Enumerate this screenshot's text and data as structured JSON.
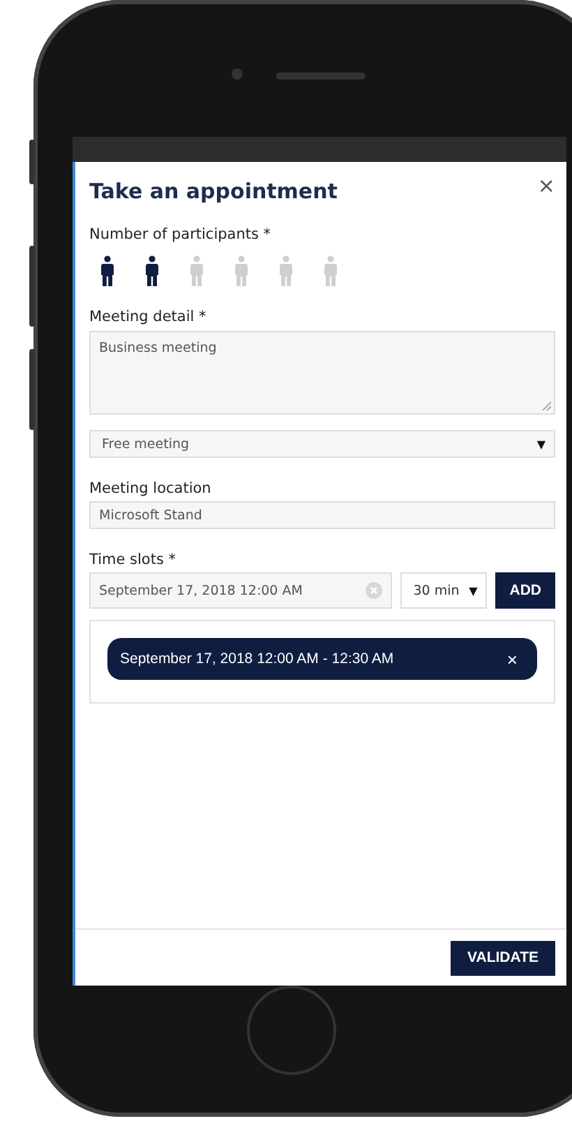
{
  "dialog": {
    "title": "Take an appointment",
    "close": "×"
  },
  "participants": {
    "label": "Number of participants *",
    "people": [
      {
        "selected": true
      },
      {
        "selected": true
      },
      {
        "selected": false
      },
      {
        "selected": false
      },
      {
        "selected": false
      },
      {
        "selected": false
      }
    ]
  },
  "meeting_detail": {
    "label": "Meeting detail *",
    "value": "Business meeting"
  },
  "meeting_type": {
    "value": "Free meeting",
    "caret": "▼"
  },
  "meeting_location": {
    "label": "Meeting location",
    "value": "Microsoft Stand"
  },
  "time_slots": {
    "label": "Time slots *",
    "date_value": "September 17, 2018 12:00 AM",
    "duration": "30 min",
    "caret": "▼",
    "add_button": "ADD",
    "slots": [
      {
        "text": "September 17, 2018 12:00 AM - 12:30 AM",
        "remove": "×"
      }
    ]
  },
  "footer": {
    "validate_button": "VALIDATE"
  }
}
